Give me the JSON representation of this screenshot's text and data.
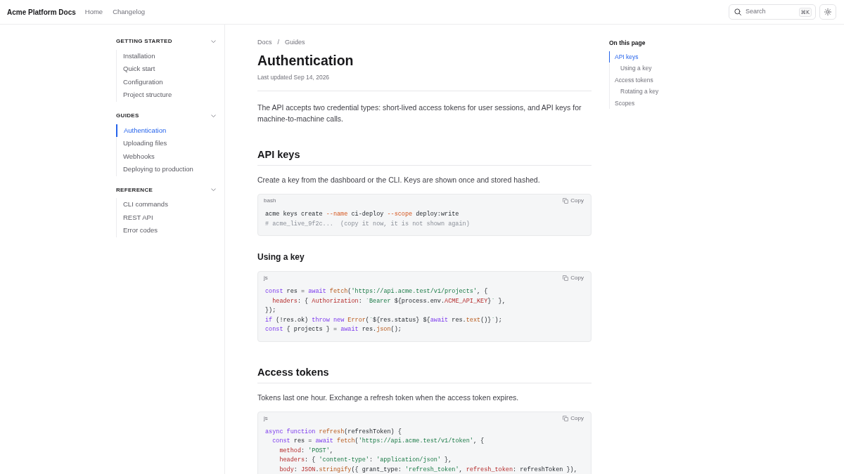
{
  "header": {
    "logo": "Acme Platform Docs",
    "nav": [
      {
        "label": "Home"
      },
      {
        "label": "Changelog"
      }
    ],
    "search": {
      "label": "Search",
      "shortcut": "⌘K"
    }
  },
  "sidebar": {
    "sections": [
      {
        "title": "GETTING STARTED",
        "expanded": true,
        "items": [
          {
            "label": "Installation",
            "selected": false
          },
          {
            "label": "Quick start",
            "selected": false
          },
          {
            "label": "Configuration",
            "selected": false
          },
          {
            "label": "Project structure",
            "selected": false
          }
        ]
      },
      {
        "title": "GUIDES",
        "expanded": true,
        "items": [
          {
            "label": "Authentication",
            "selected": true
          },
          {
            "label": "Uploading files",
            "selected": false
          },
          {
            "label": "Webhooks",
            "selected": false
          },
          {
            "label": "Deploying to production",
            "selected": false
          }
        ]
      },
      {
        "title": "REFERENCE",
        "expanded": true,
        "items": [
          {
            "label": "CLI commands",
            "selected": false
          },
          {
            "label": "REST API",
            "selected": false
          },
          {
            "label": "Error codes",
            "selected": false
          }
        ]
      }
    ]
  },
  "article": {
    "breadcrumb": {
      "items": [
        "Docs",
        "Guides"
      ],
      "separator": "/"
    },
    "title": "Authentication",
    "updated": "Last updated Sep 14, 2026",
    "blocks": [
      {
        "kind": "paragraph",
        "text": "The API accepts two credential types: short-lived access tokens for user sessions, and API keys for machine-to-machine calls."
      },
      {
        "kind": "heading",
        "text": "API keys"
      },
      {
        "kind": "paragraph",
        "text": "Create a key from the dashboard or the CLI. Keys are shown once and stored hashed."
      },
      {
        "kind": "code",
        "language": "bash",
        "copy_label": "Copy",
        "lines": [
          [
            {
              "kind": "plain",
              "text": "acme keys create "
            },
            {
              "kind": "flag",
              "text": "--name"
            },
            {
              "kind": "plain",
              "text": " ci-deploy "
            },
            {
              "kind": "flag",
              "text": "--scope"
            },
            {
              "kind": "plain",
              "text": " deploy:write"
            }
          ],
          [
            {
              "kind": "comment",
              "text": "# acme_live_9f2c...  (copy it now, it is not shown again)"
            }
          ]
        ]
      },
      {
        "kind": "subheading",
        "text": "Using a key"
      },
      {
        "kind": "code",
        "language": "js",
        "copy_label": "Copy",
        "lines": [
          [
            {
              "kind": "keyword",
              "text": "const"
            },
            {
              "kind": "plain",
              "text": " res = "
            },
            {
              "kind": "keyword",
              "text": "await"
            },
            {
              "kind": "function",
              "text": " fetch"
            },
            {
              "kind": "plain",
              "text": "("
            },
            {
              "kind": "string",
              "text": "'https://api.acme.test/v1/projects'"
            },
            {
              "kind": "plain",
              "text": ", {"
            }
          ],
          [
            {
              "kind": "property",
              "text": "  headers"
            },
            {
              "kind": "plain",
              "text": ": { "
            },
            {
              "kind": "property",
              "text": "Authorization"
            },
            {
              "kind": "plain",
              "text": ": "
            },
            {
              "kind": "string",
              "text": "`Bearer "
            },
            {
              "kind": "plain",
              "text": "${process.env."
            },
            {
              "kind": "property",
              "text": "ACME_API_KEY"
            },
            {
              "kind": "plain",
              "text": "}"
            },
            {
              "kind": "string",
              "text": "`"
            },
            {
              "kind": "plain",
              "text": " },"
            }
          ],
          [
            {
              "kind": "plain",
              "text": "});"
            }
          ],
          [
            {
              "kind": "keyword",
              "text": "if"
            },
            {
              "kind": "plain",
              "text": " (!res.ok) "
            },
            {
              "kind": "keyword",
              "text": "throw"
            },
            {
              "kind": "keyword",
              "text": " new"
            },
            {
              "kind": "function",
              "text": " Error"
            },
            {
              "kind": "plain",
              "text": "("
            },
            {
              "kind": "string",
              "text": "`"
            },
            {
              "kind": "plain",
              "text": "${res.status} ${"
            },
            {
              "kind": "keyword",
              "text": "await"
            },
            {
              "kind": "plain",
              "text": " res."
            },
            {
              "kind": "function",
              "text": "text"
            },
            {
              "kind": "plain",
              "text": "()}"
            },
            {
              "kind": "string",
              "text": "`"
            },
            {
              "kind": "plain",
              "text": ");"
            }
          ],
          [
            {
              "kind": "keyword",
              "text": "const"
            },
            {
              "kind": "plain",
              "text": " { projects } = "
            },
            {
              "kind": "keyword",
              "text": "await"
            },
            {
              "kind": "plain",
              "text": " res."
            },
            {
              "kind": "function",
              "text": "json"
            },
            {
              "kind": "plain",
              "text": "();"
            }
          ]
        ]
      },
      {
        "kind": "heading",
        "text": "Access tokens"
      },
      {
        "kind": "paragraph",
        "text": "Tokens last one hour. Exchange a refresh token when the access token expires."
      },
      {
        "kind": "code",
        "language": "js",
        "copy_label": "Copy",
        "lines": [
          [
            {
              "kind": "keyword",
              "text": "async"
            },
            {
              "kind": "keyword",
              "text": " function"
            },
            {
              "kind": "function",
              "text": " refresh"
            },
            {
              "kind": "plain",
              "text": "(refreshToken) {"
            }
          ],
          [
            {
              "kind": "keyword",
              "text": "  const"
            },
            {
              "kind": "plain",
              "text": " res = "
            },
            {
              "kind": "keyword",
              "text": "await"
            },
            {
              "kind": "function",
              "text": " fetch"
            },
            {
              "kind": "plain",
              "text": "("
            },
            {
              "kind": "string",
              "text": "'https://api.acme.test/v1/token'"
            },
            {
              "kind": "plain",
              "text": ", {"
            }
          ],
          [
            {
              "kind": "property",
              "text": "    method"
            },
            {
              "kind": "plain",
              "text": ": "
            },
            {
              "kind": "string",
              "text": "'POST'"
            },
            {
              "kind": "plain",
              "text": ","
            }
          ],
          [
            {
              "kind": "property",
              "text": "    headers"
            },
            {
              "kind": "plain",
              "text": ": { "
            },
            {
              "kind": "string",
              "text": "'content-type'"
            },
            {
              "kind": "plain",
              "text": ": "
            },
            {
              "kind": "string",
              "text": "'application/json'"
            },
            {
              "kind": "plain",
              "text": " },"
            }
          ],
          [
            {
              "kind": "property",
              "text": "    body"
            },
            {
              "kind": "plain",
              "text": ": "
            },
            {
              "kind": "property",
              "text": "JSON"
            },
            {
              "kind": "plain",
              "text": "."
            },
            {
              "kind": "function",
              "text": "stringify"
            },
            {
              "kind": "plain",
              "text": "({ grant_type: "
            },
            {
              "kind": "string",
              "text": "'refresh_token'"
            },
            {
              "kind": "plain",
              "text": ", "
            },
            {
              "kind": "property",
              "text": "refresh_token"
            },
            {
              "kind": "plain",
              "text": ": refreshToken }),"
            }
          ]
        ]
      }
    ]
  },
  "toc": {
    "title": "On this page",
    "items": [
      {
        "label": "API keys",
        "selected": true,
        "children": [
          {
            "label": "Using a key",
            "selected": false
          }
        ]
      },
      {
        "label": "Access tokens",
        "selected": false,
        "children": [
          {
            "label": "Rotating a key",
            "selected": false
          }
        ]
      },
      {
        "label": "Scopes",
        "selected": false
      }
    ]
  }
}
